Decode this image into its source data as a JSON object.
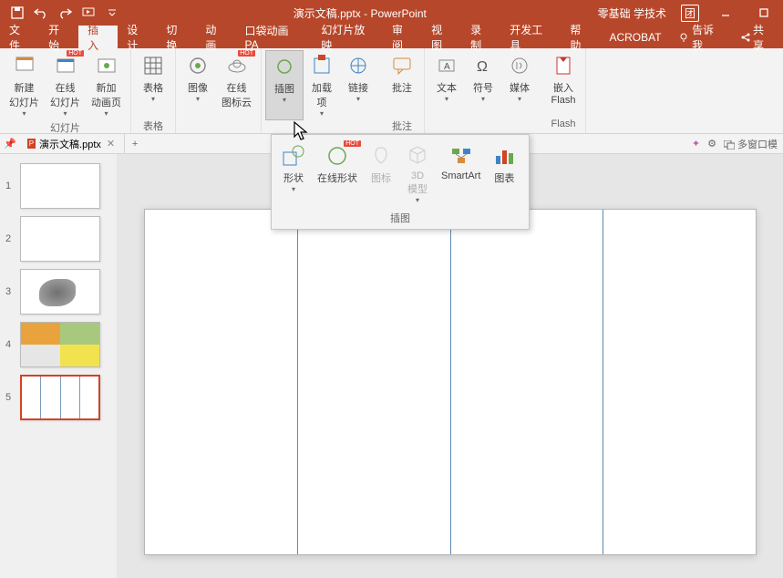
{
  "title": {
    "filename": "演示文稿.pptx",
    "app": "PowerPoint",
    "right_text": "零基础 学技术",
    "group_icon": "团"
  },
  "qat": {
    "save": "保存",
    "undo": "撤销",
    "redo": "重做",
    "start": "从头开始"
  },
  "tabs": {
    "file": "文件",
    "home": "开始",
    "insert": "插入",
    "design": "设计",
    "transitions": "切换",
    "animations": "动画",
    "pocket_anim": "口袋动画 PA",
    "slideshow": "幻灯片放映",
    "review": "审阅",
    "view": "视图",
    "record": "录制",
    "developer": "开发工具",
    "help": "帮助",
    "acrobat": "ACROBAT",
    "tell_me": "告诉我",
    "share": "共享"
  },
  "ribbon": {
    "new_slide": "新建\n幻灯片",
    "online_slides": "在线\n幻灯片",
    "new_anim": "新加\n动画页",
    "group_slides": "幻灯片",
    "table": "表格",
    "group_table": "表格",
    "image": "图像",
    "online_icons": "在线\n图标云",
    "illustration": "插图",
    "addins": "加载\n项",
    "link": "链接",
    "comment": "批注",
    "group_comment": "批注",
    "textbox": "文本",
    "symbol": "符号",
    "media": "媒体",
    "flash": "嵌入\nFlash",
    "group_flash": "Flash",
    "hot": "HOT"
  },
  "dropdown": {
    "shape": "形状",
    "online_shape": "在线形状",
    "icon": "图标",
    "model3d": "3D\n模型",
    "smartart": "SmartArt",
    "chart": "图表",
    "label": "插图",
    "hot": "HOT"
  },
  "doctab": {
    "name": "演示文稿.pptx",
    "multi_window": "多窗口模"
  },
  "thumbs": {
    "n1": "1",
    "n2": "2",
    "n3": "3",
    "n4": "4",
    "n5": "5"
  }
}
